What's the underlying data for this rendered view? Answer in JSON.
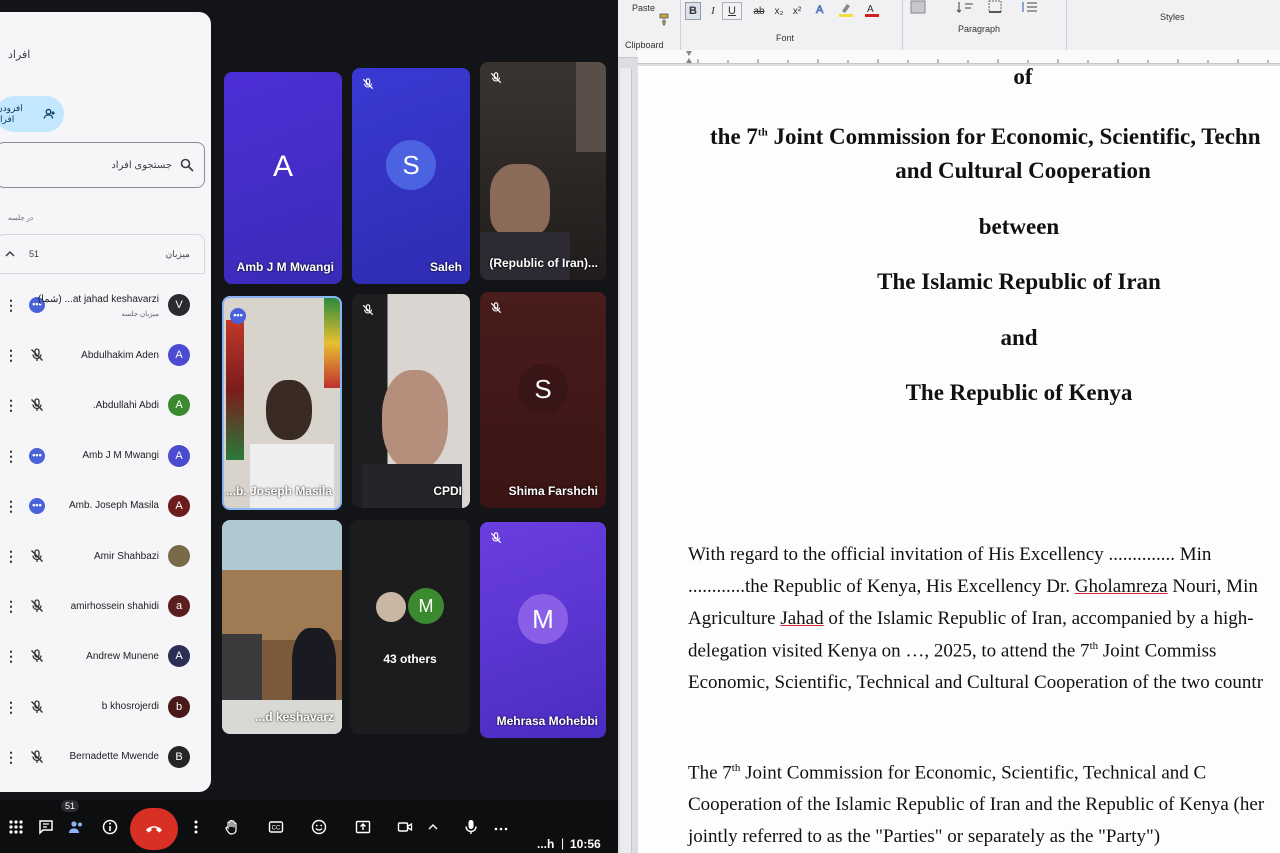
{
  "meet": {
    "people_panel": {
      "title": "افراد",
      "add_people_label": "افزودن افراد",
      "search_placeholder": "جستجوی افراد",
      "in_call_label": "در جلسه",
      "section_label": "میزبان",
      "section_count": "51",
      "participants": [
        {
          "name": "(شما) ...at jahad keshavarzi",
          "subtitle": "میزبان جلسه",
          "initial": "V",
          "avatar_color": "#2b2b2f",
          "status": "more"
        },
        {
          "name": "Abdulhakim Aden",
          "initial": "A",
          "avatar_color": "#4a4bd1",
          "status": "muted"
        },
        {
          "name": ".Abdullahi Abdi",
          "initial": "A",
          "avatar_color": "#3c8a2f",
          "status": "muted"
        },
        {
          "name": "Amb J M Mwangi",
          "initial": "A",
          "avatar_color": "#4a4bd1",
          "status": "more"
        },
        {
          "name": "Amb. Joseph Masila",
          "initial": "A",
          "avatar_color": "#6b1d1d",
          "status": "more"
        },
        {
          "name": "Amir Shahbazi",
          "initial": "",
          "avatar_color": "#7a6a4a",
          "status": "muted"
        },
        {
          "name": "amirhossein shahidi",
          "initial": "a",
          "avatar_color": "#5a1e1e",
          "status": "muted"
        },
        {
          "name": "Andrew Munene",
          "initial": "A",
          "avatar_color": "#2b2f55",
          "status": "muted"
        },
        {
          "name": "b khosrojerdi",
          "initial": "b",
          "avatar_color": "#4a1a1a",
          "status": "muted"
        },
        {
          "name": "Bernadette Mwende",
          "initial": "B",
          "avatar_color": "#252528",
          "status": "muted"
        }
      ]
    },
    "tiles": [
      {
        "name": "Amb J M Mwangi",
        "initial": "A"
      },
      {
        "name": "Saleh",
        "initial": "S"
      },
      {
        "name": "(Republic of Iran)..."
      },
      {
        "name": "...b. Joseph Masila"
      },
      {
        "name": "CPDI"
      },
      {
        "name": "Shima Farshchi",
        "initial": "S"
      },
      {
        "name": "...d keshavarz"
      },
      {
        "name": "43 others",
        "initial": "M"
      },
      {
        "name": "Mehrasa Mohebbi",
        "initial": "M"
      }
    ],
    "controls": {
      "participants_badge": "51",
      "time_prefix": "...h",
      "time": "10:56"
    }
  },
  "word": {
    "ribbon": {
      "paste_label": "Paste",
      "clipboard_label": "Clipboard",
      "font_label": "Font",
      "paragraph_label": "Paragraph",
      "styles_label": "Styles",
      "bold": "B",
      "italic": "I",
      "underline": "U",
      "strike": "ab",
      "subscript": "x₂",
      "superscript": "x²"
    },
    "document": {
      "line_of": "of",
      "line_commission_a": "the 7",
      "line_commission_sup": "th",
      "line_commission_b": " Joint Commission for Economic, Scientific, Techn",
      "line_cultural": "and Cultural Cooperation",
      "line_between": "between",
      "line_iran": "The Islamic Republic of Iran",
      "line_and": "and",
      "line_kenya": "The Republic of Kenya",
      "p1_l1": "With  regard  to  the  official  invitation  of  His  Excellency  ..............  Min",
      "p1_l2": "............the Republic of Kenya, His Excellency Dr. ",
      "p1_l2_name": "Gholamreza",
      "p1_l2_rest": " Nouri, Min",
      "p1_l3_a": "Agriculture ",
      "p1_l3_jahad": "Jahad",
      "p1_l3_b": " of the Islamic Republic of Iran, accompanied by a high-",
      "p1_l4_a": "delegation  visited  Kenya  on  …,  2025,  to  attend  the  7",
      "p1_l4_sup": "th",
      "p1_l4_b": "  Joint  Commiss",
      "p1_l5": "Economic, Scientific, Technical and Cultural Cooperation of the two countr",
      "p2_l1_a": "The  7",
      "p2_l1_sup": "th",
      "p2_l1_b": "  Joint  Commission  for  Economic,  Scientific,  Technical  and  C",
      "p2_l2": "Cooperation of the Islamic Republic of Iran and the Republic of Kenya (her",
      "p2_l3": "jointly referred to as the \"Parties\" or separately as the \"Party\")"
    }
  }
}
